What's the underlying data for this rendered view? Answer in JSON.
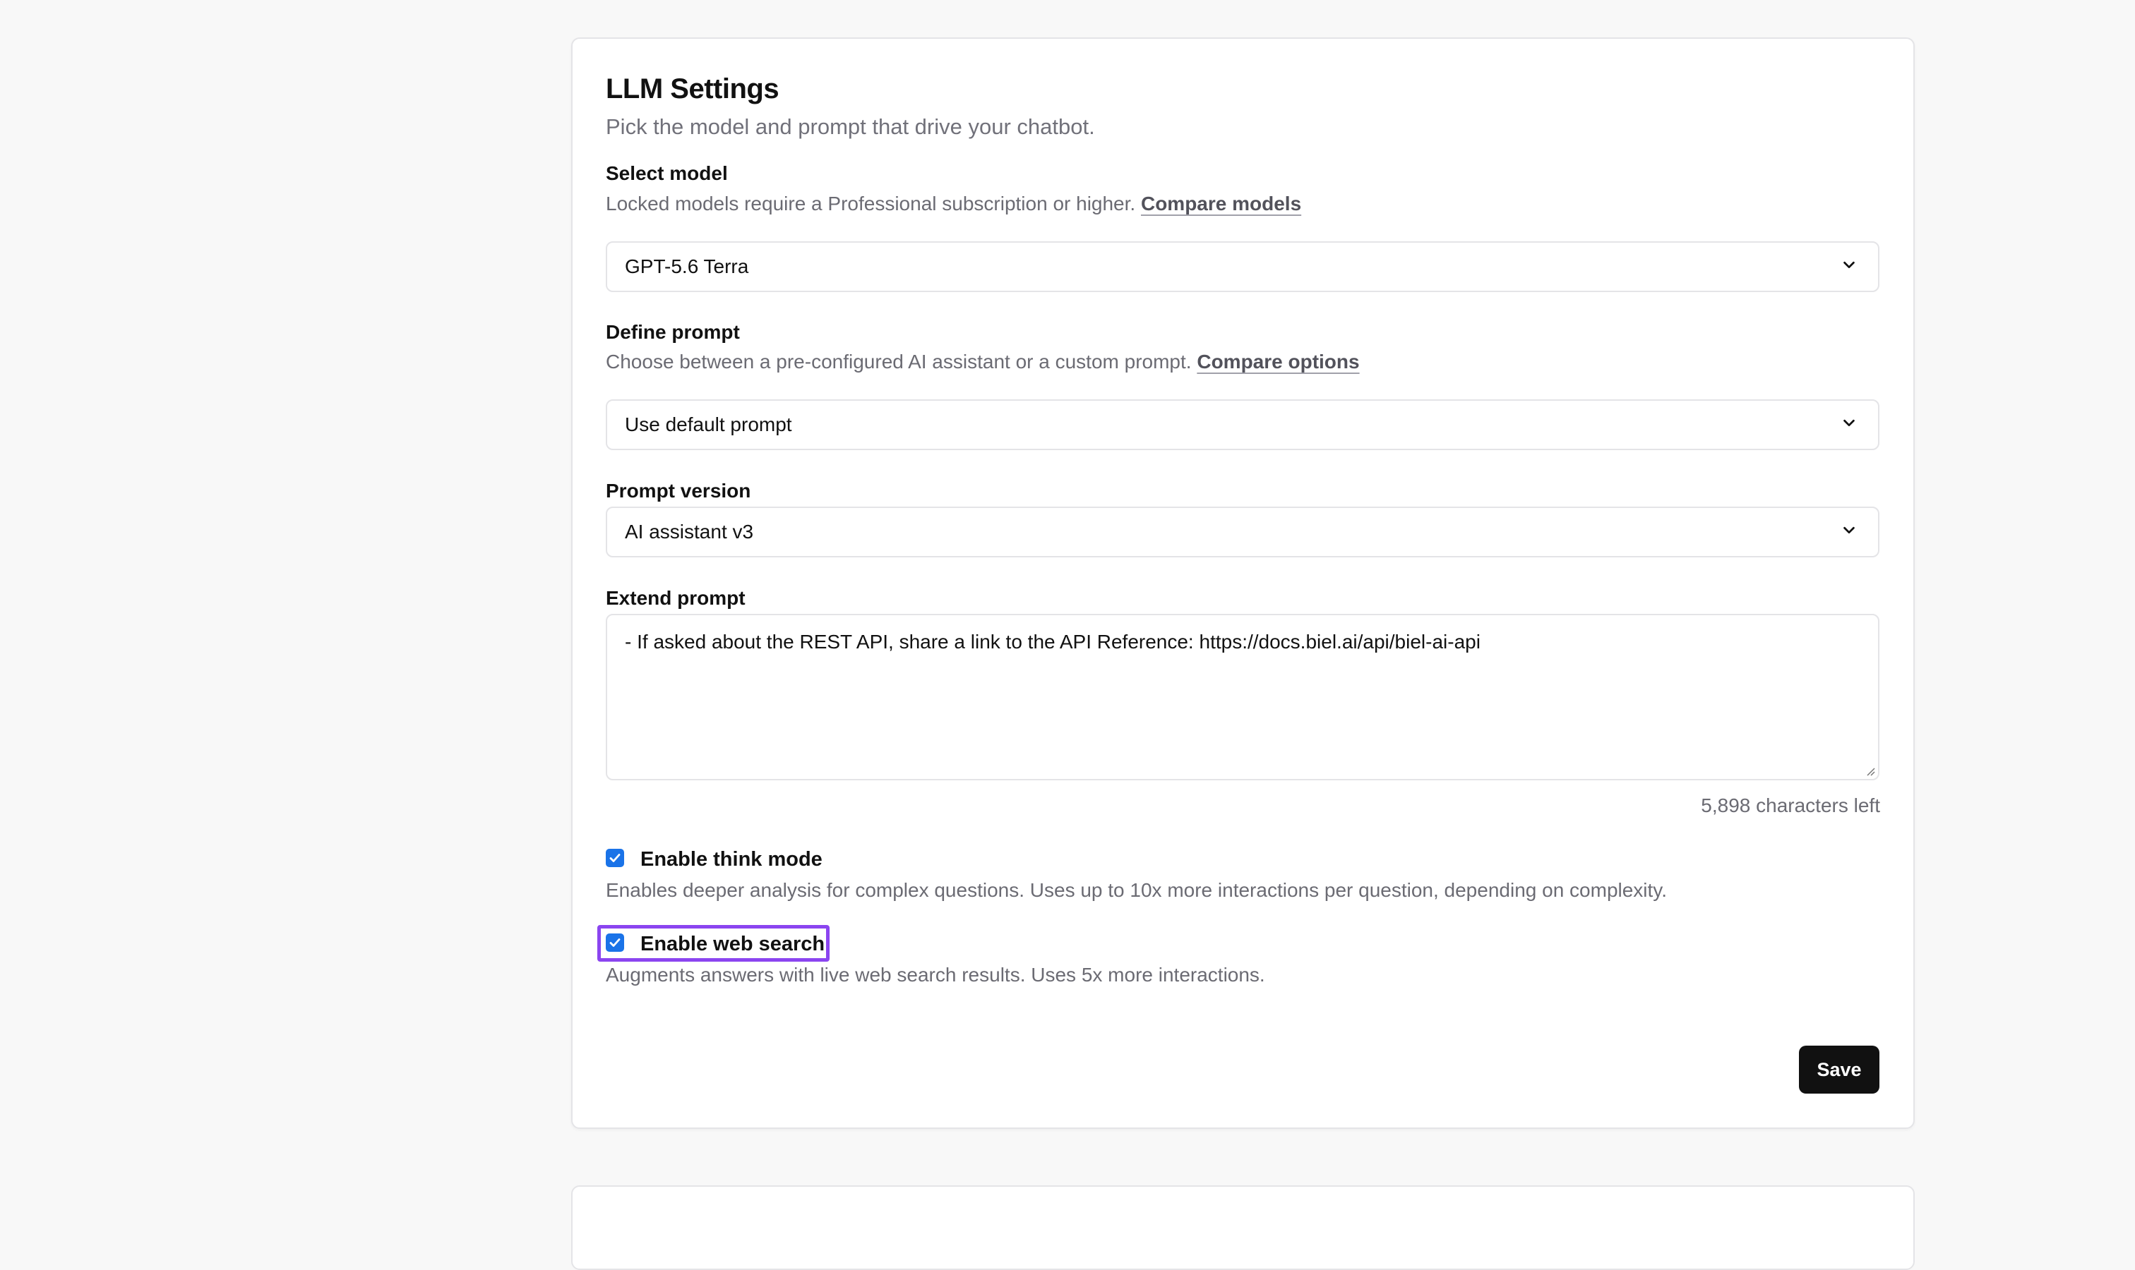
{
  "settings": {
    "title": "LLM Settings",
    "subtitle": "Pick the model and prompt that drive your chatbot."
  },
  "select_model": {
    "label": "Select model",
    "help": "Locked models require a Professional subscription or higher.",
    "link": "Compare models",
    "value": "GPT-5.6 Terra",
    "icon": "chevron-down-icon"
  },
  "define_prompt": {
    "label": "Define prompt",
    "help": "Choose between a pre-configured AI assistant or a custom prompt.",
    "link": "Compare options",
    "value": "Use default prompt",
    "icon": "chevron-down-icon"
  },
  "prompt_version": {
    "label": "Prompt version",
    "value": "AI assistant v3",
    "icon": "chevron-down-icon"
  },
  "extend_prompt": {
    "label": "Extend prompt",
    "value": "- If asked about the REST API, share a link to the API Reference: https://docs.biel.ai/api/biel-ai-api",
    "counter": "5,898 characters left"
  },
  "think_mode": {
    "label": "Enable think mode",
    "checked": true,
    "help": "Enables deeper analysis for complex questions. Uses up to 10x more interactions per question, depending on complexity."
  },
  "web_search": {
    "label": "Enable web search",
    "checked": true,
    "focused": true,
    "help": "Augments answers with live web search results. Uses 5x more interactions."
  },
  "actions": {
    "save_label": "Save"
  },
  "colors": {
    "checkbox": "#1a73e8",
    "focus_ring": "#8b45f0",
    "save_button": "#111111"
  }
}
